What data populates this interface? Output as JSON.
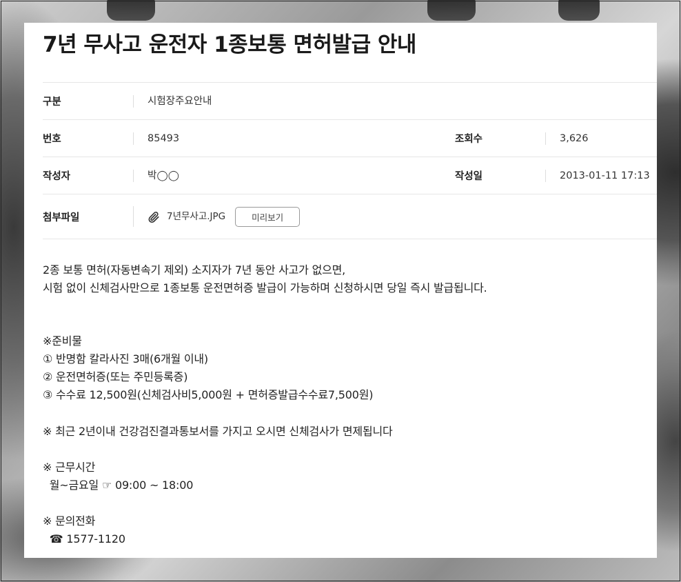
{
  "page": {
    "title": "7년 무사고 운전자 1종보통 면허발급 안내"
  },
  "info": {
    "category_label": "구분",
    "category_value": "시험장주요안내",
    "number_label": "번호",
    "number_value": "85493",
    "views_label": "조회수",
    "views_value": "3,626",
    "author_label": "작성자",
    "author_value": "박◯◯",
    "date_label": "작성일",
    "date_value": "2013-01-11 17:13",
    "attachment_label": "첨부파일",
    "attachment_icon": "paperclip-icon",
    "attachment_file": "7년무사고.JPG",
    "preview_label": "미리보기"
  },
  "content": {
    "intro_1": "2종 보통 면허(자동변속기 제외) 소지자가 7년 동안 사고가 없으면,",
    "intro_2": "시험 없이 신체검사만으로 1종보통 운전면허증 발급이 가능하며 신청하시면 당일 즉시 발급됩니다.",
    "prep_heading": "※준비물",
    "prep_1": "① 반명함 칼라사진 3매(6개월 이내)",
    "prep_2": "② 운전면허증(또는 주민등록증)",
    "prep_3": "③ 수수료 12,500원(신체검사비5,000원 + 면허증발급수수료7,500원)",
    "exemption_note": "※ 최근 2년이내 건강검진결과통보서를 가지고 오시면 신체검사가 면제됩니다",
    "hours_heading": "※ 근무시간",
    "hours_value": "  월~금요일 ☞ 09:00 ~ 18:00",
    "phone_heading": "※ 문의전화",
    "phone_value": "  ☎ 1577-1120"
  },
  "colors": {
    "page_background": "#ffffff",
    "text": "#222222",
    "divider": "#e6e6e6"
  }
}
